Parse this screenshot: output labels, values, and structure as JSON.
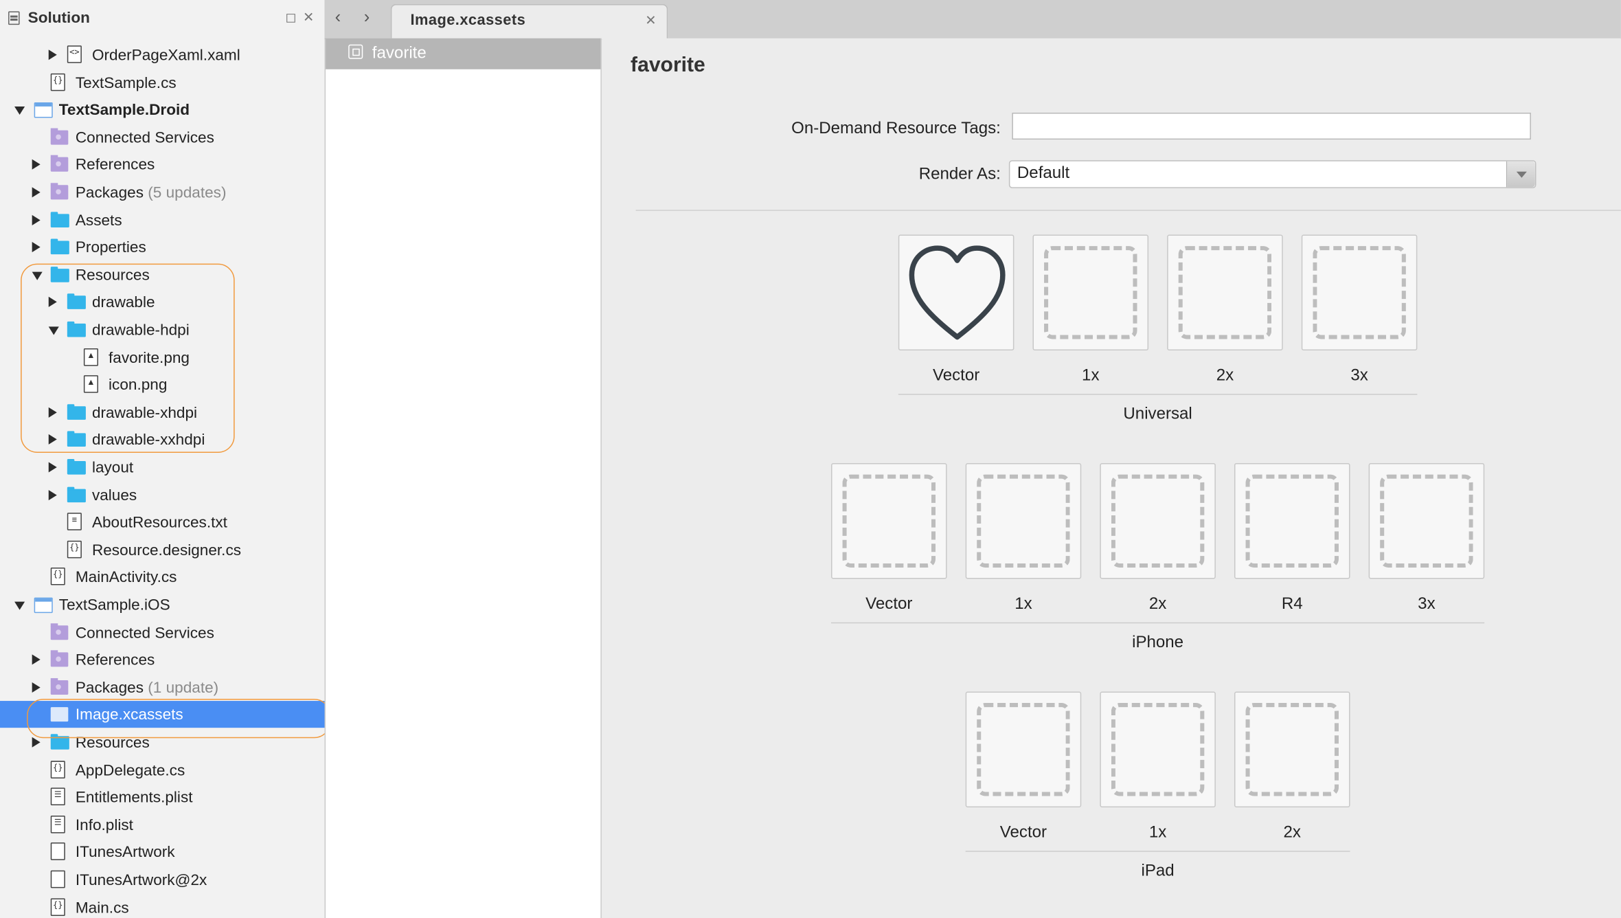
{
  "sidebar": {
    "title": "Solution",
    "items": [
      {
        "label": "OrderPageXaml.xaml",
        "icon": "xaml-file-icon",
        "glyph": "<>",
        "arrow": "right",
        "level": 3,
        "bold": false
      },
      {
        "label": "TextSample.cs",
        "icon": "code-file-icon",
        "glyph": "{}",
        "arrow": "none",
        "level": 2,
        "bold": false
      },
      {
        "label": "TextSample.Droid",
        "icon": "project-icon",
        "arrow": "down",
        "level": 1,
        "bold": true
      },
      {
        "label": "Connected Services",
        "icon": "connected-services-icon",
        "arrow": "none",
        "level": 2,
        "bold": false
      },
      {
        "label": "References",
        "icon": "references-icon",
        "arrow": "right",
        "level": 2,
        "bold": false
      },
      {
        "label": "Packages",
        "sub": "(5 updates)",
        "icon": "packages-icon",
        "arrow": "right",
        "level": 2,
        "bold": false
      },
      {
        "label": "Assets",
        "icon": "folder-icon",
        "arrow": "right",
        "level": 2,
        "bold": false
      },
      {
        "label": "Properties",
        "icon": "folder-icon",
        "arrow": "right",
        "level": 2,
        "bold": false
      },
      {
        "label": "Resources",
        "icon": "folder-icon",
        "arrow": "down",
        "level": 2,
        "bold": false
      },
      {
        "label": "drawable",
        "icon": "folder-icon",
        "arrow": "right",
        "level": 3,
        "bold": false
      },
      {
        "label": "drawable-hdpi",
        "icon": "folder-icon",
        "arrow": "down",
        "level": 3,
        "bold": false
      },
      {
        "label": "favorite.png",
        "icon": "image-file-icon",
        "glyph": "▲",
        "arrow": "none",
        "level": 4,
        "bold": false
      },
      {
        "label": "icon.png",
        "icon": "image-file-icon",
        "glyph": "▲",
        "arrow": "none",
        "level": 4,
        "bold": false
      },
      {
        "label": "drawable-xhdpi",
        "icon": "folder-icon",
        "arrow": "right",
        "level": 3,
        "bold": false
      },
      {
        "label": "drawable-xxhdpi",
        "icon": "folder-icon",
        "arrow": "right",
        "level": 3,
        "bold": false
      },
      {
        "label": "layout",
        "icon": "folder-icon",
        "arrow": "right",
        "level": 3,
        "bold": false
      },
      {
        "label": "values",
        "icon": "folder-icon",
        "arrow": "right",
        "level": 3,
        "bold": false
      },
      {
        "label": "AboutResources.txt",
        "icon": "text-file-icon",
        "glyph": "≡",
        "arrow": "none",
        "level": 3,
        "bold": false
      },
      {
        "label": "Resource.designer.cs",
        "icon": "code-file-icon",
        "glyph": "{}",
        "arrow": "none",
        "level": 3,
        "bold": false
      },
      {
        "label": "MainActivity.cs",
        "icon": "code-file-icon",
        "glyph": "{}",
        "arrow": "none",
        "level": 2,
        "bold": false
      },
      {
        "label": "TextSample.iOS",
        "icon": "project-icon",
        "arrow": "down",
        "level": 1,
        "bold": false
      },
      {
        "label": "Connected Services",
        "icon": "connected-services-icon",
        "arrow": "none",
        "level": 2,
        "bold": false
      },
      {
        "label": "References",
        "icon": "references-icon",
        "arrow": "right",
        "level": 2,
        "bold": false
      },
      {
        "label": "Packages",
        "sub": "(1 update)",
        "icon": "packages-icon",
        "arrow": "right",
        "level": 2,
        "bold": false
      },
      {
        "label": "Image.xcassets",
        "icon": "asset-catalog-icon",
        "arrow": "none",
        "level": 2,
        "bold": false,
        "selected": true
      },
      {
        "label": "Resources",
        "icon": "folder-icon",
        "arrow": "right",
        "level": 2,
        "bold": false
      },
      {
        "label": "AppDelegate.cs",
        "icon": "code-file-icon",
        "glyph": "{}",
        "arrow": "none",
        "level": 2,
        "bold": false
      },
      {
        "label": "Entitlements.plist",
        "icon": "plist-file-icon",
        "glyph": "☰",
        "arrow": "none",
        "level": 2,
        "bold": false
      },
      {
        "label": "Info.plist",
        "icon": "plist-file-icon",
        "glyph": "☰",
        "arrow": "none",
        "level": 2,
        "bold": false
      },
      {
        "label": "ITunesArtwork",
        "icon": "blank-file-icon",
        "glyph": "",
        "arrow": "none",
        "level": 2,
        "bold": false
      },
      {
        "label": "ITunesArtwork@2x",
        "icon": "blank-file-icon",
        "glyph": "",
        "arrow": "none",
        "level": 2,
        "bold": false
      },
      {
        "label": "Main.cs",
        "icon": "code-file-icon",
        "glyph": "{}",
        "arrow": "none",
        "level": 2,
        "bold": false
      }
    ]
  },
  "tabs": [
    {
      "label": "Image.xcassets",
      "active": true
    }
  ],
  "asset_list": {
    "items": [
      {
        "label": "favorite",
        "selected": true
      }
    ]
  },
  "editor": {
    "asset_name": "favorite",
    "odr_label": "On-Demand Resource Tags:",
    "odr_value": "",
    "render_label": "Render As:",
    "render_value": "Default",
    "groups": [
      {
        "name": "Universal",
        "slots": [
          "Vector",
          "1x",
          "2x",
          "3x"
        ],
        "filled": [
          0
        ]
      },
      {
        "name": "iPhone",
        "slots": [
          "Vector",
          "1x",
          "2x",
          "R4",
          "3x"
        ],
        "filled": []
      },
      {
        "name": "iPad",
        "slots": [
          "Vector",
          "1x",
          "2x"
        ],
        "filled": []
      }
    ]
  },
  "colors": {
    "selection": "#4a8ef3",
    "folder": "#33b5ea",
    "highlight": "#f19a3e"
  }
}
